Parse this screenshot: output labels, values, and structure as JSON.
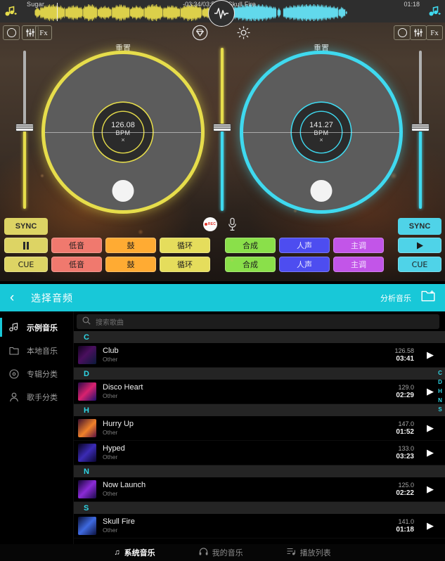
{
  "colors": {
    "yellow": "#e6dd4b",
    "cyan": "#3fd9ef",
    "accent": "#18c8d8",
    "rec": "#e0342a"
  },
  "decks": {
    "left": {
      "track_title": "Sugar",
      "time": "-03:34/03:50",
      "reset_label": "重置",
      "bpm": "126.08",
      "bpm_label": "BPM",
      "bpm_x": "×",
      "sync_label": "SYNC",
      "cue_label": "CUE",
      "transport_icon": "pause-icon",
      "toolbar": [
        {
          "name": "loop-icon",
          "label": ""
        },
        {
          "name": "equalizer-icon",
          "label": ""
        },
        {
          "name": "fx-button",
          "label": "Fx"
        }
      ],
      "pads_row1": [
        {
          "label": "低音",
          "color": "#f0796e"
        },
        {
          "label": "鼓",
          "color": "#ffab33"
        },
        {
          "label": "循环",
          "color": "#e5dd5c"
        }
      ],
      "pads_row2": [
        {
          "label": "低音",
          "color": "#f0796e"
        },
        {
          "label": "鼓",
          "color": "#ffab33"
        },
        {
          "label": "循环",
          "color": "#e5dd5c"
        }
      ]
    },
    "right": {
      "track_title": "Skull Fire",
      "time": "01:18",
      "reset_label": "重置",
      "bpm": "141.27",
      "bpm_label": "BPM",
      "bpm_x": "×",
      "sync_label": "SYNC",
      "cue_label": "CUE",
      "transport_icon": "play-icon",
      "toolbar": [
        {
          "name": "loop-icon",
          "label": ""
        },
        {
          "name": "equalizer-icon",
          "label": ""
        },
        {
          "name": "fx-button",
          "label": "Fx"
        }
      ],
      "pads_row1": [
        {
          "label": "合成",
          "color": "#8ae04a"
        },
        {
          "label": "人声",
          "color": "#4d4df0"
        },
        {
          "label": "主调",
          "color": "#c255e8"
        }
      ],
      "pads_row2": [
        {
          "label": "合成",
          "color": "#8ae04a"
        },
        {
          "label": "人声",
          "color": "#4d4df0"
        },
        {
          "label": "主调",
          "color": "#c255e8"
        }
      ]
    }
  },
  "center": {
    "diamond_icon": "diamond-icon",
    "settings_icon": "gear-icon",
    "rec_label": "REC",
    "mic_icon": "microphone-icon",
    "vu_icon": "waveform-icon"
  },
  "browser": {
    "back_icon": "chevron-left-icon",
    "title": "选择音频",
    "analyze_label": "分析音乐",
    "folder_icon": "add-folder-icon",
    "search_placeholder": "搜索歌曲",
    "search_value": "",
    "search_icon": "search-icon",
    "sidebar": [
      {
        "label": "示例音乐",
        "icon": "music-note-icon",
        "active": true
      },
      {
        "label": "本地音乐",
        "icon": "folder-icon",
        "active": false
      },
      {
        "label": "专辑分类",
        "icon": "album-icon",
        "active": false
      },
      {
        "label": "歌手分类",
        "icon": "artist-icon",
        "active": false
      }
    ],
    "alpha_index": [
      "C",
      "D",
      "H",
      "N",
      "S"
    ],
    "sections": [
      {
        "letter": "C",
        "tracks": [
          {
            "title": "Club",
            "artist": "Other",
            "bpm": "126.58",
            "duration": "03:41",
            "art": "linear-gradient(135deg,#12021f,#4a0f5e 45%,#0a1a3a)"
          }
        ]
      },
      {
        "letter": "D",
        "tracks": [
          {
            "title": "Disco Heart",
            "artist": "Other",
            "bpm": "129.0",
            "duration": "02:29",
            "art": "linear-gradient(135deg,#2b0a4a,#d9226e 50%,#1c0f6e)"
          }
        ]
      },
      {
        "letter": "H",
        "tracks": [
          {
            "title": "Hurry Up",
            "artist": "Other",
            "bpm": "147.0",
            "duration": "01:52",
            "art": "linear-gradient(135deg,#3a0d2e,#f0822a 55%,#5a1040)"
          },
          {
            "title": "Hyped",
            "artist": "Other",
            "bpm": "133.0",
            "duration": "03:23",
            "art": "linear-gradient(135deg,#07021c,#3b2bb5 50%,#0a0630)"
          }
        ]
      },
      {
        "letter": "N",
        "tracks": [
          {
            "title": "Now Launch",
            "artist": "Other",
            "bpm": "125.0",
            "duration": "02:22",
            "art": "linear-gradient(135deg,#120433,#8b2bd6 50%,#1b0a4a)"
          }
        ]
      },
      {
        "letter": "S",
        "tracks": [
          {
            "title": "Skull Fire",
            "artist": "Other",
            "bpm": "141.0",
            "duration": "01:18",
            "art": "linear-gradient(135deg,#0a0f33,#3f6ae0 50%,#0c1240)"
          }
        ]
      }
    ],
    "bottom_nav": [
      {
        "label": "系统音乐",
        "icon": "music-note-icon",
        "active": true
      },
      {
        "label": "我的音乐",
        "icon": "headphones-icon",
        "active": false
      },
      {
        "label": "播放列表",
        "icon": "playlist-icon",
        "active": false
      }
    ]
  }
}
